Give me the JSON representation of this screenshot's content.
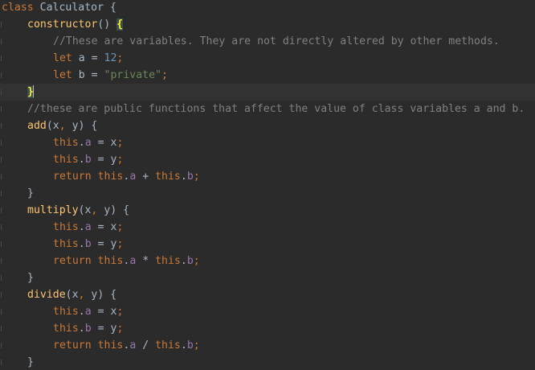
{
  "theme": {
    "background": "#2b2b2b",
    "keyword": "#cc7832",
    "function": "#ffc66d",
    "property": "#9876aa",
    "number": "#6897bb",
    "string": "#6a8759",
    "comment": "#808080",
    "plain": "#a9b7c6",
    "brace_match": "#ffef28"
  },
  "editor": {
    "current_line": 5,
    "lines": [
      {
        "indent": 0,
        "tokens": [
          {
            "t": "class",
            "c": "keyword"
          },
          {
            "t": " Calculator {",
            "c": "plain"
          }
        ]
      },
      {
        "indent": 1,
        "tokens": [
          {
            "t": "constructor",
            "c": "function"
          },
          {
            "t": "() ",
            "c": "plain"
          },
          {
            "t": "{",
            "c": "brace-match"
          }
        ]
      },
      {
        "indent": 2,
        "tokens": [
          {
            "t": "//These are variables. They are not directly altered by other methods.",
            "c": "comment"
          }
        ]
      },
      {
        "indent": 2,
        "tokens": [
          {
            "t": "let",
            "c": "keyword"
          },
          {
            "t": " a = ",
            "c": "plain"
          },
          {
            "t": "12",
            "c": "number"
          },
          {
            "t": ";",
            "c": "punct"
          }
        ]
      },
      {
        "indent": 2,
        "tokens": [
          {
            "t": "let",
            "c": "keyword"
          },
          {
            "t": " b = ",
            "c": "plain"
          },
          {
            "t": "\"private\"",
            "c": "string"
          },
          {
            "t": ";",
            "c": "punct"
          }
        ]
      },
      {
        "indent": 1,
        "caret": true,
        "tokens": [
          {
            "t": "}",
            "c": "brace-match"
          }
        ]
      },
      {
        "indent": 1,
        "tokens": [
          {
            "t": "//these are public functions that affect the value of class variables a and b.",
            "c": "comment"
          }
        ]
      },
      {
        "indent": 1,
        "tokens": [
          {
            "t": "add",
            "c": "function"
          },
          {
            "t": "(x",
            "c": "plain"
          },
          {
            "t": ", ",
            "c": "punct"
          },
          {
            "t": "y) {",
            "c": "plain"
          }
        ]
      },
      {
        "indent": 2,
        "tokens": [
          {
            "t": "this",
            "c": "keyword"
          },
          {
            "t": ".",
            "c": "plain"
          },
          {
            "t": "a",
            "c": "property"
          },
          {
            "t": " = x",
            "c": "plain"
          },
          {
            "t": ";",
            "c": "punct"
          }
        ]
      },
      {
        "indent": 2,
        "tokens": [
          {
            "t": "this",
            "c": "keyword"
          },
          {
            "t": ".",
            "c": "plain"
          },
          {
            "t": "b",
            "c": "property"
          },
          {
            "t": " = y",
            "c": "plain"
          },
          {
            "t": ";",
            "c": "punct"
          }
        ]
      },
      {
        "indent": 2,
        "tokens": [
          {
            "t": "return",
            "c": "keyword"
          },
          {
            "t": " ",
            "c": "plain"
          },
          {
            "t": "this",
            "c": "keyword"
          },
          {
            "t": ".",
            "c": "plain"
          },
          {
            "t": "a",
            "c": "property"
          },
          {
            "t": " + ",
            "c": "plain"
          },
          {
            "t": "this",
            "c": "keyword"
          },
          {
            "t": ".",
            "c": "plain"
          },
          {
            "t": "b",
            "c": "property"
          },
          {
            "t": ";",
            "c": "punct"
          }
        ]
      },
      {
        "indent": 1,
        "tokens": [
          {
            "t": "}",
            "c": "plain"
          }
        ]
      },
      {
        "indent": 1,
        "tokens": [
          {
            "t": "multiply",
            "c": "function"
          },
          {
            "t": "(x",
            "c": "plain"
          },
          {
            "t": ", ",
            "c": "punct"
          },
          {
            "t": "y) {",
            "c": "plain"
          }
        ]
      },
      {
        "indent": 2,
        "tokens": [
          {
            "t": "this",
            "c": "keyword"
          },
          {
            "t": ".",
            "c": "plain"
          },
          {
            "t": "a",
            "c": "property"
          },
          {
            "t": " = x",
            "c": "plain"
          },
          {
            "t": ";",
            "c": "punct"
          }
        ]
      },
      {
        "indent": 2,
        "tokens": [
          {
            "t": "this",
            "c": "keyword"
          },
          {
            "t": ".",
            "c": "plain"
          },
          {
            "t": "b",
            "c": "property"
          },
          {
            "t": " = y",
            "c": "plain"
          },
          {
            "t": ";",
            "c": "punct"
          }
        ]
      },
      {
        "indent": 2,
        "tokens": [
          {
            "t": "return",
            "c": "keyword"
          },
          {
            "t": " ",
            "c": "plain"
          },
          {
            "t": "this",
            "c": "keyword"
          },
          {
            "t": ".",
            "c": "plain"
          },
          {
            "t": "a",
            "c": "property"
          },
          {
            "t": " * ",
            "c": "plain"
          },
          {
            "t": "this",
            "c": "keyword"
          },
          {
            "t": ".",
            "c": "plain"
          },
          {
            "t": "b",
            "c": "property"
          },
          {
            "t": ";",
            "c": "punct"
          }
        ]
      },
      {
        "indent": 1,
        "tokens": [
          {
            "t": "}",
            "c": "plain"
          }
        ]
      },
      {
        "indent": 1,
        "tokens": [
          {
            "t": "divide",
            "c": "function"
          },
          {
            "t": "(x",
            "c": "plain"
          },
          {
            "t": ", ",
            "c": "punct"
          },
          {
            "t": "y) {",
            "c": "plain"
          }
        ]
      },
      {
        "indent": 2,
        "tokens": [
          {
            "t": "this",
            "c": "keyword"
          },
          {
            "t": ".",
            "c": "plain"
          },
          {
            "t": "a",
            "c": "property"
          },
          {
            "t": " = x",
            "c": "plain"
          },
          {
            "t": ";",
            "c": "punct"
          }
        ]
      },
      {
        "indent": 2,
        "tokens": [
          {
            "t": "this",
            "c": "keyword"
          },
          {
            "t": ".",
            "c": "plain"
          },
          {
            "t": "b",
            "c": "property"
          },
          {
            "t": " = y",
            "c": "plain"
          },
          {
            "t": ";",
            "c": "punct"
          }
        ]
      },
      {
        "indent": 2,
        "tokens": [
          {
            "t": "return",
            "c": "keyword"
          },
          {
            "t": " ",
            "c": "plain"
          },
          {
            "t": "this",
            "c": "keyword"
          },
          {
            "t": ".",
            "c": "plain"
          },
          {
            "t": "a",
            "c": "property"
          },
          {
            "t": " / ",
            "c": "plain"
          },
          {
            "t": "this",
            "c": "keyword"
          },
          {
            "t": ".",
            "c": "plain"
          },
          {
            "t": "b",
            "c": "property"
          },
          {
            "t": ";",
            "c": "punct"
          }
        ]
      },
      {
        "indent": 1,
        "tokens": [
          {
            "t": "}",
            "c": "plain"
          }
        ]
      }
    ]
  }
}
